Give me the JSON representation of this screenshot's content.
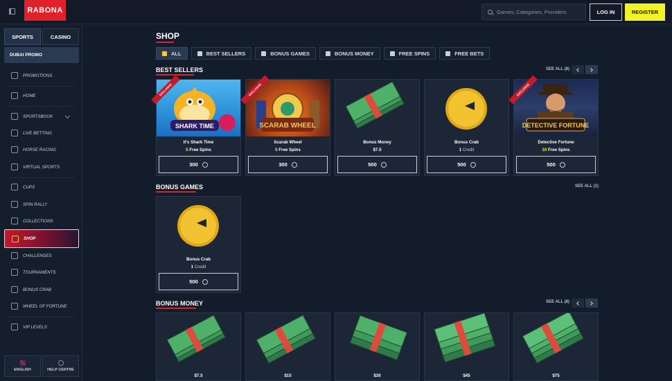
{
  "header": {
    "logo": "RABONA",
    "search_placeholder": "Games, Categories, Providers",
    "login": "LOG IN",
    "register": "REGISTER"
  },
  "sidebar": {
    "tabs": [
      "SPORTS",
      "CASINO"
    ],
    "promo": "DUBAI PROMO",
    "items": [
      {
        "label": "PROMOTIONS",
        "icon": "megaphone-icon"
      },
      {
        "label": "HOME",
        "icon": "home-icon"
      },
      {
        "label": "SPORTSBOOK",
        "icon": "ball-icon"
      },
      {
        "label": "LIVE BETTING",
        "icon": "monitor-icon"
      },
      {
        "label": "HORSE RACING",
        "icon": "horse-icon"
      },
      {
        "label": "VIRTUAL SPORTS",
        "icon": "virtual-icon"
      },
      {
        "label": "CUPS",
        "icon": "trophy-icon"
      },
      {
        "label": "SPIN RALLY",
        "icon": "flag-icon"
      },
      {
        "label": "COLLECTIONS",
        "icon": "collections-icon"
      },
      {
        "label": "SHOP",
        "icon": "cart-icon"
      },
      {
        "label": "CHALLENGES",
        "icon": "challenge-flag-icon"
      },
      {
        "label": "TOURNAMENTS",
        "icon": "tournament-icon"
      },
      {
        "label": "BONUS CRAB",
        "icon": "crab-icon"
      },
      {
        "label": "WHEEL OF FORTUNE",
        "icon": "wheel-icon"
      },
      {
        "label": "VIP LEVELS",
        "icon": "diamond-icon"
      }
    ],
    "bottom": [
      "ENGLISH",
      "HELP CENTRE"
    ]
  },
  "shop": {
    "title": "SHOP",
    "filters": [
      "ALL",
      "BEST SELLERS",
      "BONUS GAMES",
      "BONUS MONEY",
      "FREE SPINS",
      "FREE BETS"
    ],
    "best_sellers": {
      "title": "BEST SELLERS",
      "see_all": "SEE ALL (8)",
      "items": [
        {
          "name": "It's Shark Time",
          "qty": "5",
          "unit": "Free Spins",
          "price": "300",
          "badge": "EXCLUSIVE",
          "art": "SHARK TIME"
        },
        {
          "name": "Scarab Wheel",
          "qty": "5",
          "unit": "Free Spins",
          "price": "300",
          "badge": "EXCLUSIVE",
          "art": "SCARAB WHEEL"
        },
        {
          "name": "Bonus Money",
          "qty": "$7.5",
          "unit": "",
          "price": "500",
          "badge": "",
          "art": ""
        },
        {
          "name": "Bonus Crab",
          "qty": "1",
          "unit": "Credit",
          "price": "500",
          "badge": "",
          "art": ""
        },
        {
          "name": "Detective Fortune",
          "qty": "10",
          "unit": "Free Spins",
          "price": "500",
          "badge": "EXCLUSIVE",
          "art": "DETECTIVE FORTUNE"
        }
      ]
    },
    "bonus_games": {
      "title": "BONUS GAMES",
      "see_all": "SEE ALL (1)",
      "items": [
        {
          "name": "Bonus Crab",
          "qty": "1",
          "unit": "Credit",
          "price": "500"
        }
      ]
    },
    "bonus_money": {
      "title": "BONUS MONEY",
      "see_all": "SEE ALL (8)",
      "items": [
        "$7.5",
        "$15",
        "$30",
        "$45",
        "$75"
      ]
    }
  }
}
